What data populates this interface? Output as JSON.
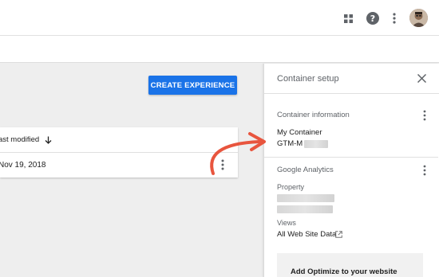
{
  "topbar": {
    "icons": [
      "apps-grid-icon",
      "help-icon",
      "more-vert-icon"
    ],
    "avatar": "user-avatar"
  },
  "main": {
    "create_button_label": "CREATE EXPERIENCE",
    "table": {
      "column_header": "ast modified",
      "sort_icon": "arrow-down-icon",
      "rows": [
        {
          "date": "Nov 19, 2018"
        }
      ]
    }
  },
  "panel": {
    "title": "Container setup",
    "container_info": {
      "heading": "Container information",
      "name": "My Container",
      "id_prefix": "GTM-M"
    },
    "analytics": {
      "heading": "Google Analytics",
      "property_label": "Property",
      "views_label": "Views",
      "views_value": "All Web Site Data"
    },
    "optimize_card_title": "Add Optimize to your website"
  },
  "colors": {
    "accent": "#1a73e8",
    "annotation_arrow": "#e8553e"
  }
}
